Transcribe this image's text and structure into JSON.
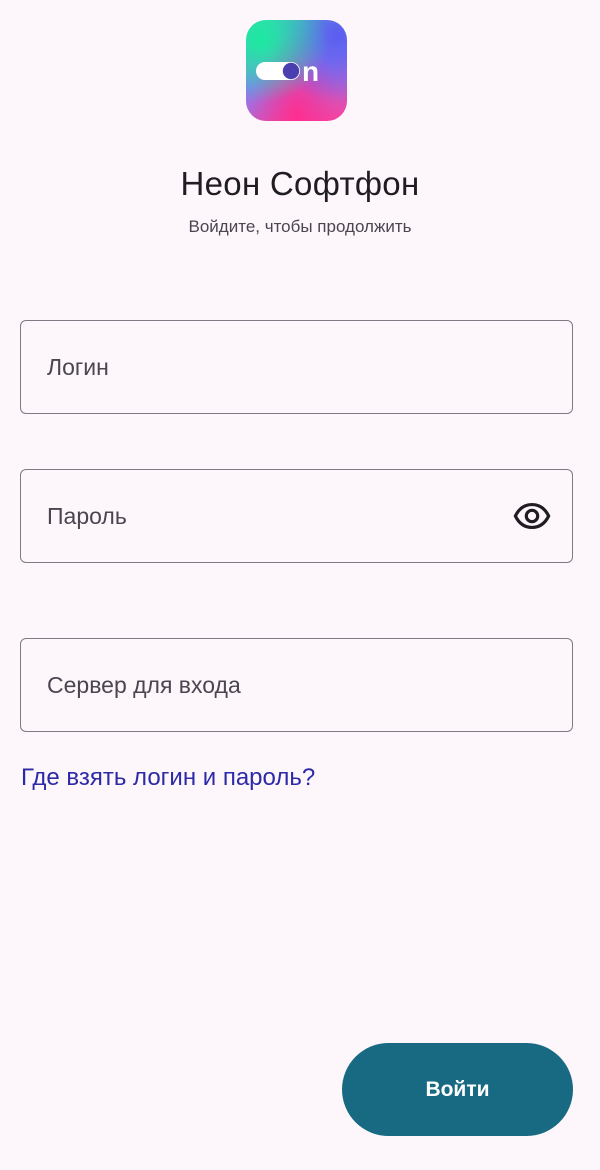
{
  "app": {
    "title": "Неон Софтфон",
    "subtitle": "Войдите, чтобы продолжить",
    "logo_icon": "neon-on-toggle-icon"
  },
  "form": {
    "login": {
      "placeholder": "Логин",
      "value": ""
    },
    "password": {
      "placeholder": "Пароль",
      "value": "",
      "toggle_icon": "eye-icon"
    },
    "server": {
      "placeholder": "Сервер для входа",
      "value": ""
    },
    "help_link": "Где взять логин и пароль?",
    "submit_label": "Войти"
  },
  "colors": {
    "background": "#fdf7fc",
    "primary_button": "#176a82",
    "link": "#2c2aa6",
    "field_border": "#7f7a84",
    "text": "#1f1c22"
  }
}
